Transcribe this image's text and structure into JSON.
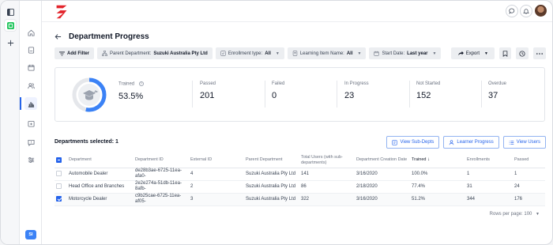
{
  "page": {
    "title": "Department Progress"
  },
  "filters": {
    "add_filter": "Add Filter",
    "parent_department_label": "Parent Department:",
    "parent_department_value": "Suzuki Australia Pty Ltd",
    "enrollment_type_label": "Enrollment type:",
    "enrollment_type_value": "All",
    "learning_item_label": "Learning Item Name:",
    "learning_item_value": "All",
    "start_date_label": "Start Date:",
    "start_date_value": "Last year"
  },
  "actions": {
    "export": "Export"
  },
  "summary": {
    "trained_label": "Trained",
    "trained_value": "53.5%",
    "trained_fraction": 0.535,
    "passed_label": "Passed",
    "passed_value": "201",
    "failed_label": "Failed",
    "failed_value": "0",
    "in_progress_label": "In Progress",
    "in_progress_value": "23",
    "not_started_label": "Not Started",
    "not_started_value": "152",
    "overdue_label": "Overdue",
    "overdue_value": "37"
  },
  "departments_selected": "Departments selected: 1",
  "buttons": {
    "view_sub_depts": "View Sub-Depts",
    "learner_progress": "Learner Progress",
    "view_users": "View Users"
  },
  "table": {
    "headers": {
      "department": "Department",
      "department_id": "Department ID",
      "external_id": "External ID",
      "parent_department": "Parent Department",
      "total_users": "Total Users (with sub-departments)",
      "creation_date": "Department Creation Date",
      "trained": "Trained",
      "enrollments": "Enrollments",
      "passed": "Passed"
    },
    "rows": [
      {
        "department": "Automobile Dealer",
        "department_id": "de28b3ae-6725-11ea-afa0-",
        "external_id": "4",
        "parent_department": "Suzuki Australia Pty Ltd",
        "total_users": "141",
        "creation_date": "3/16/2020",
        "trained": "100.0%",
        "enrollments": "1",
        "passed": "1"
      },
      {
        "department": "Head Office and Branches",
        "department_id": "2e2e274a-51db-11ea-8afb-",
        "external_id": "2",
        "parent_department": "Suzuki Australia Pty Ltd",
        "total_users": "86",
        "creation_date": "2/18/2020",
        "trained": "77.4%",
        "enrollments": "31",
        "passed": "24"
      },
      {
        "department": "Motorcycle Dealer",
        "department_id": "c9b25cae-6725-11ea-af05-",
        "external_id": "3",
        "parent_department": "Suzuki Australia Pty Ltd",
        "total_users": "322",
        "creation_date": "3/16/2020",
        "trained": "51.2%",
        "enrollments": "344",
        "passed": "176"
      }
    ]
  },
  "pager": {
    "rows_per_page": "Rows per page: 100"
  },
  "user": {
    "initials": "SI"
  },
  "colors": {
    "accent": "#2563eb",
    "brand_red": "#e3242b"
  }
}
